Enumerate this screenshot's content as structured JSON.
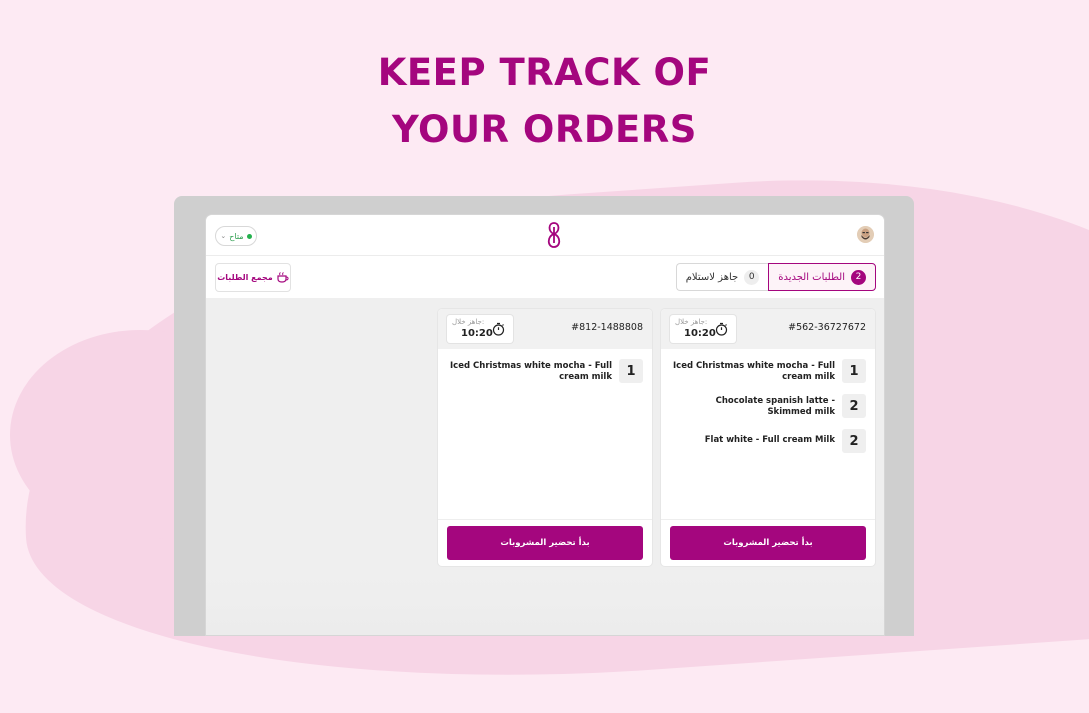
{
  "headline": {
    "line1": "KEEP TRACK OF",
    "line2": "YOUR ORDERS"
  },
  "colors": {
    "brand": "#a4067e",
    "status_green": "#23b14d",
    "background": "#fdeaf3"
  },
  "topbar": {
    "status_label": "متاح",
    "status_icon": "chevron-down-icon",
    "logo_icon": "brand-logo-icon",
    "avatar_icon": "user-avatar-icon"
  },
  "toolbar": {
    "hub_label": "مجمع الطلبات",
    "hub_icon": "coffee-cup-icon",
    "tabs": [
      {
        "label": "الطلبات الجديدة",
        "count": "2",
        "active": true
      },
      {
        "label": "جاهز لاستلام",
        "count": "0",
        "active": false
      }
    ]
  },
  "orders": [
    {
      "id": "#562-36727672",
      "ready_label": "جاهز خلال:",
      "ready_time": "10:20",
      "items": [
        {
          "name": "Iced Christmas white mocha - Full cream milk",
          "qty": "1"
        },
        {
          "name": "Chocolate spanish latte - Skimmed milk",
          "qty": "2"
        },
        {
          "name": "Flat white - Full cream Milk",
          "qty": "2"
        }
      ],
      "action_label": "بدأ تحضير المشروبات"
    },
    {
      "id": "#812-1488808",
      "ready_label": "جاهز خلال:",
      "ready_time": "10:20",
      "items": [
        {
          "name": "Iced Christmas white mocha - Full cream milk",
          "qty": "1"
        }
      ],
      "action_label": "بدأ تحضير المشروبات"
    }
  ]
}
